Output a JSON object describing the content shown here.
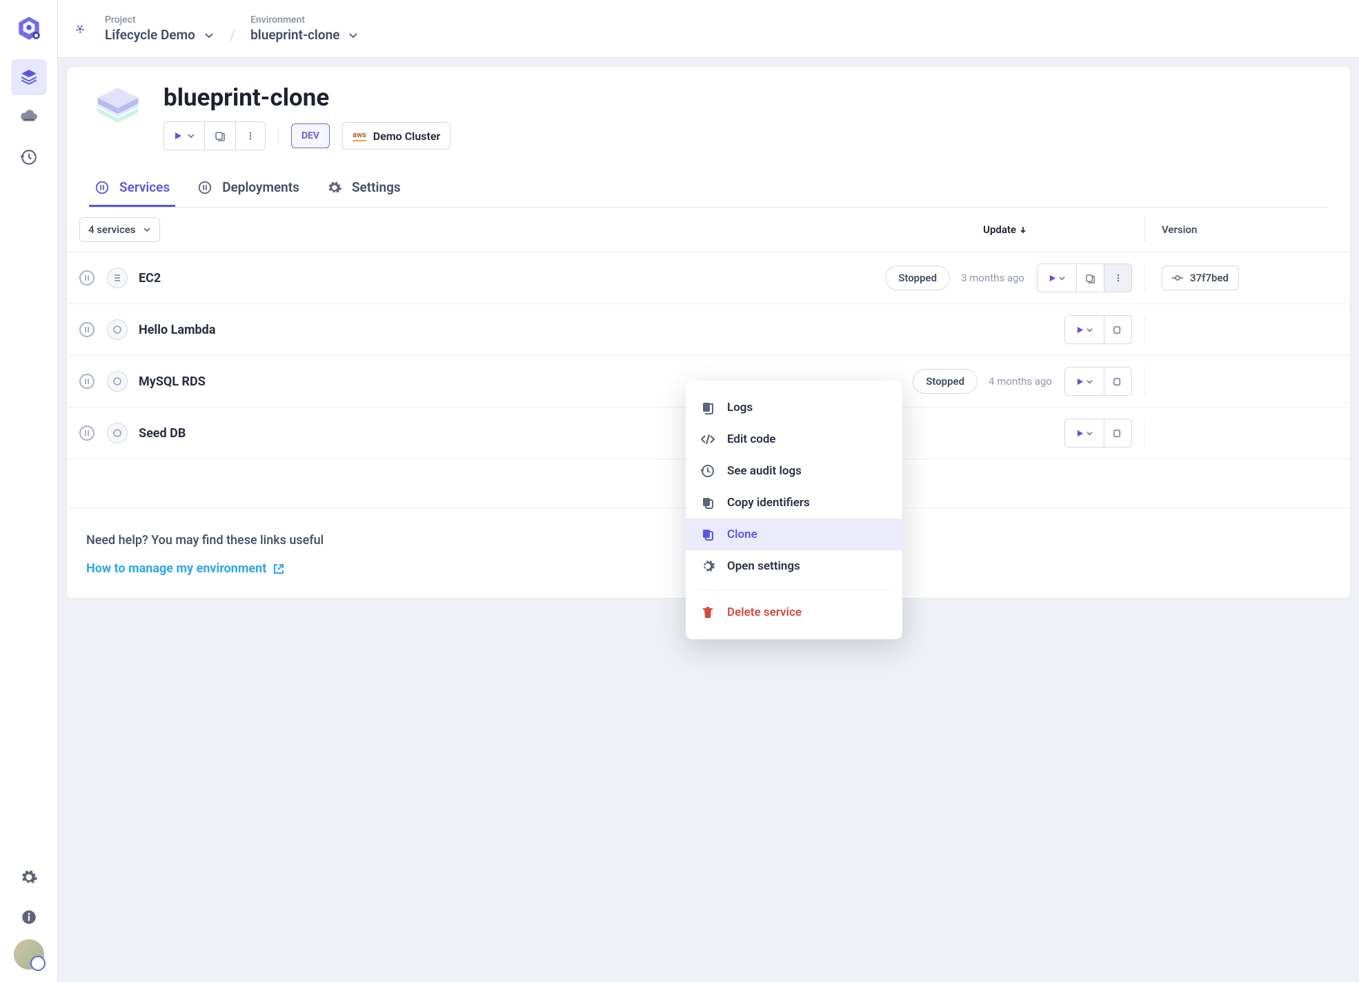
{
  "breadcrumb": {
    "project_label": "Project",
    "project_value": "Lifecycle Demo",
    "env_label": "Environment",
    "env_value": "blueprint-clone"
  },
  "header": {
    "title": "blueprint-clone",
    "dev_badge": "DEV",
    "cluster_provider": "aws",
    "cluster_name": "Demo Cluster"
  },
  "tabs": {
    "services": "Services",
    "deployments": "Deployments",
    "settings": "Settings"
  },
  "table": {
    "filter": "4 services",
    "col_update": "Update",
    "col_version": "Version",
    "rows": [
      {
        "name": "EC2",
        "status": "Stopped",
        "updated": "3 months ago",
        "version": "37f7bed"
      },
      {
        "name": "Hello Lambda",
        "status": "",
        "updated": "",
        "version": ""
      },
      {
        "name": "MySQL RDS",
        "status": "Stopped",
        "updated": "4 months ago",
        "version": ""
      },
      {
        "name": "Seed DB",
        "status": "",
        "updated": "",
        "version": ""
      }
    ]
  },
  "context_menu": {
    "logs": "Logs",
    "edit_code": "Edit code",
    "audit": "See audit logs",
    "copy_ids": "Copy identifiers",
    "clone": "Clone",
    "open_settings": "Open settings",
    "delete": "Delete service"
  },
  "help": {
    "title": "Need help? You may find these links useful",
    "link1": "How to manage my environment"
  }
}
